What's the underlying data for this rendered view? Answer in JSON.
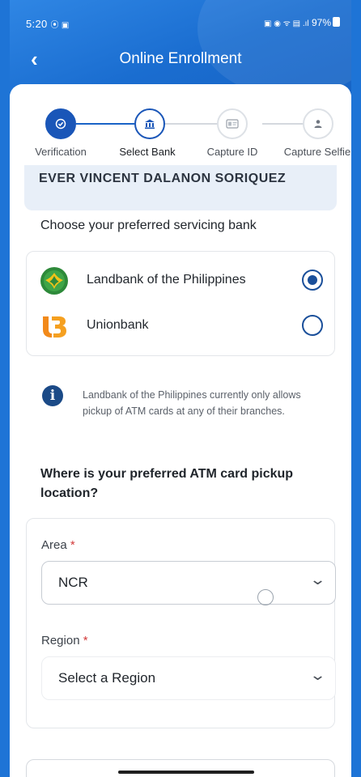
{
  "status_bar": {
    "time": "5:20",
    "left_icons": "⦿ ▣",
    "right_icons": "▣ ◉ ᯤ ▤ .ıl",
    "battery": "97%"
  },
  "topbar": {
    "title": "Online Enrollment",
    "back_icon": "chevron-left-icon"
  },
  "stepper": {
    "steps": [
      {
        "label": "Verification",
        "state": "done",
        "icon": "check-icon"
      },
      {
        "label": "Select Bank",
        "state": "current",
        "icon": "bank-icon"
      },
      {
        "label": "Capture ID",
        "state": "todo",
        "icon": "id-card-icon"
      },
      {
        "label": "Capture Selfie",
        "state": "todo",
        "icon": "person-icon"
      }
    ]
  },
  "account_name": "EVER VINCENT DALANON SORIQUEZ",
  "bank_section": {
    "title": "Choose your preferred servicing bank",
    "banks": [
      {
        "name": "Landbank of the Philippines",
        "selected": true
      },
      {
        "name": "Unionbank",
        "selected": false
      }
    ]
  },
  "info": {
    "text": "Landbank of the Philippines currently only allows pickup of ATM cards at any of their branches."
  },
  "pickup": {
    "title": "Where is your preferred ATM card pickup location?",
    "area_label": "Area",
    "area_value": "NCR",
    "region_label": "Region",
    "region_placeholder": "Select a Region",
    "required_mark": "*"
  },
  "colors": {
    "primary": "#1a63c7",
    "header": "#1e74d6",
    "required": "#d23a3a"
  }
}
